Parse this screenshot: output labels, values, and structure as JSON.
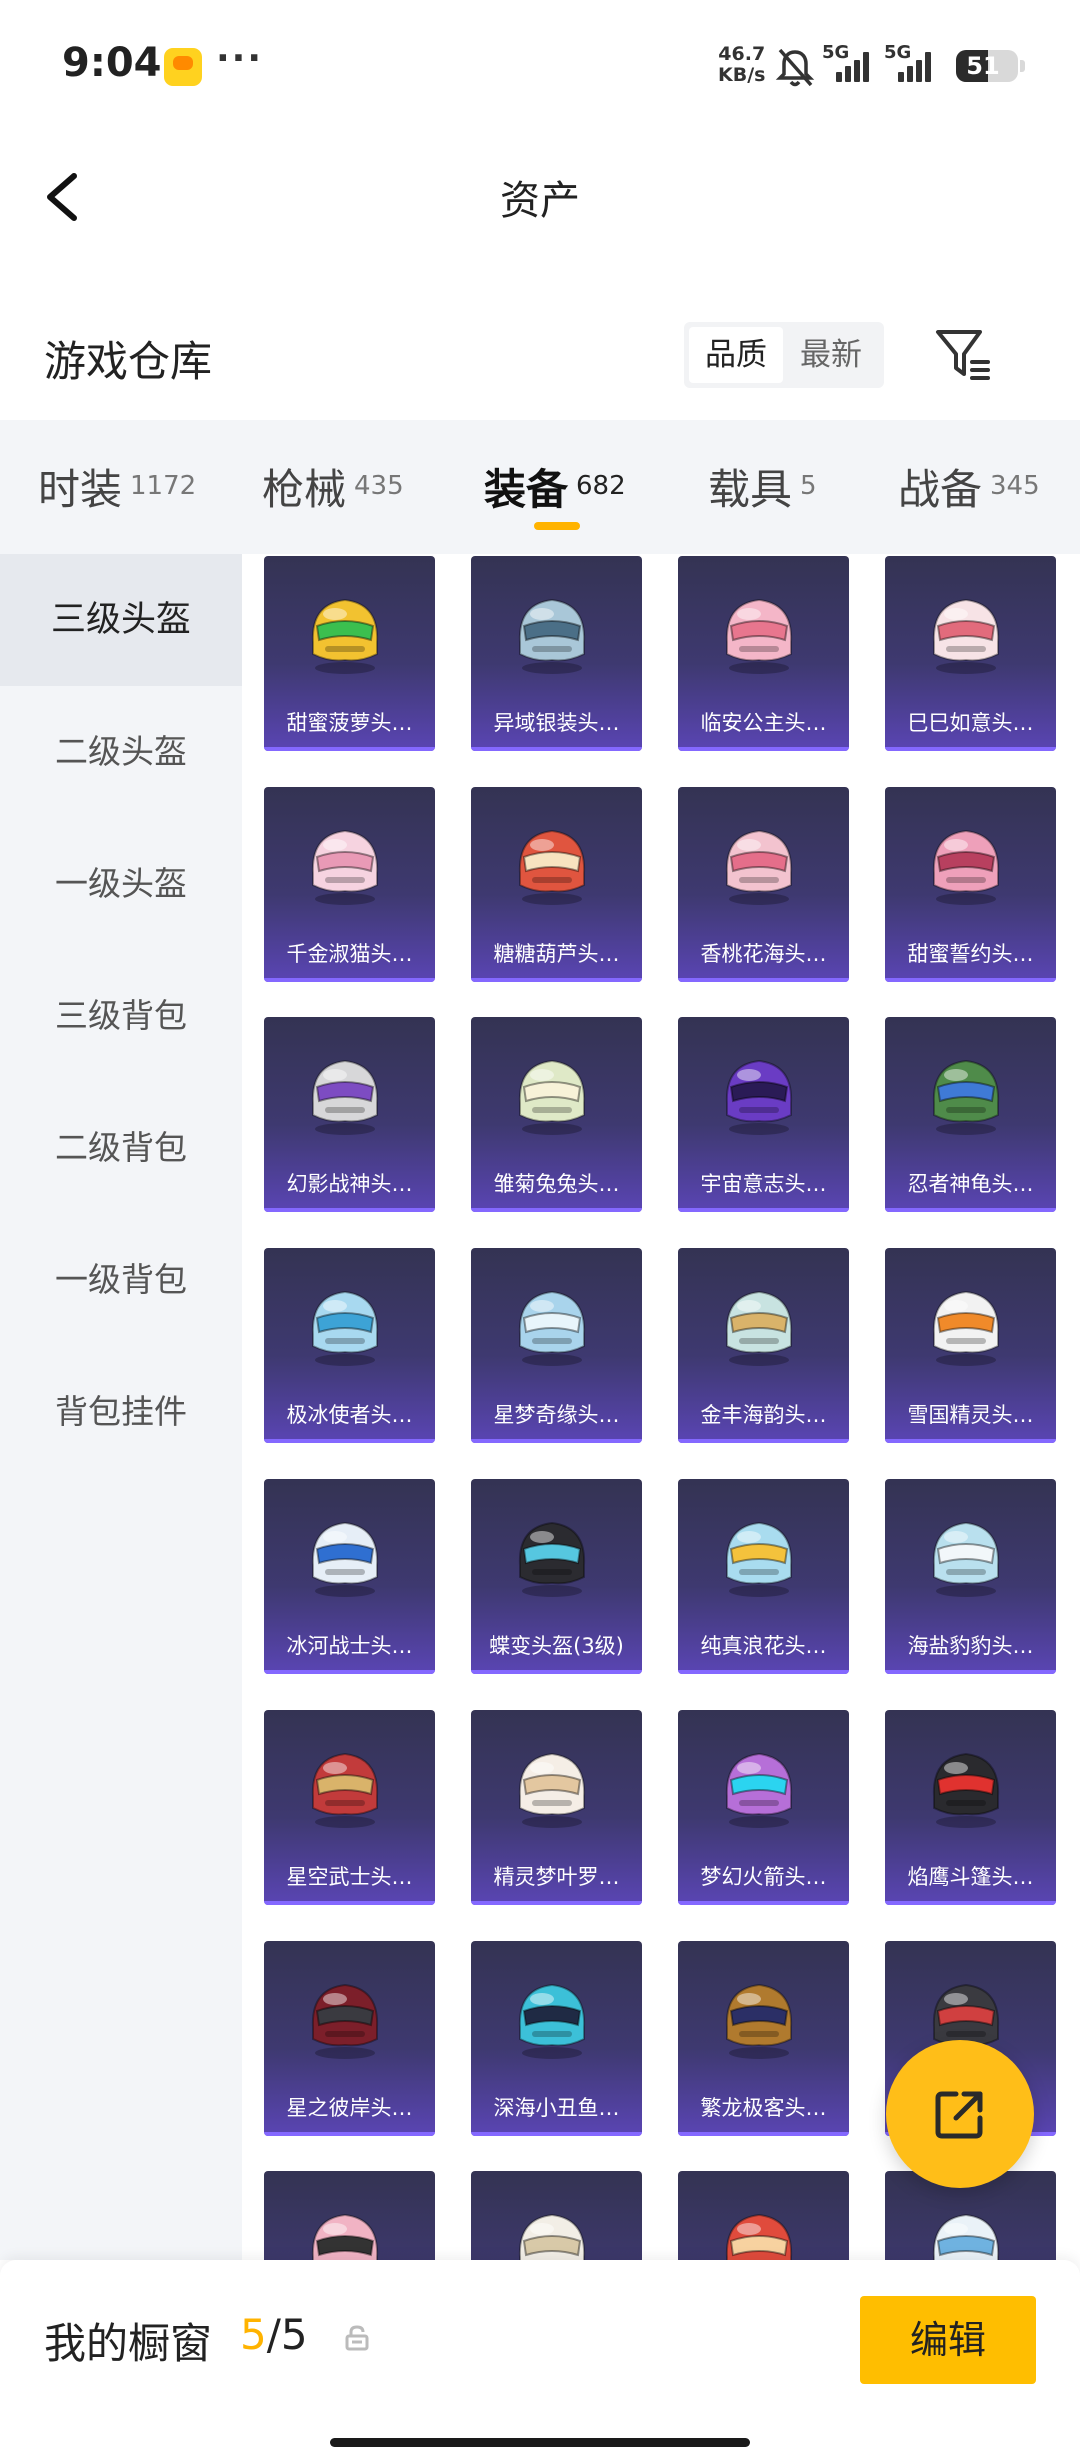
{
  "status_bar": {
    "time": "9:04",
    "more": "···",
    "speed_value": "46.7",
    "speed_unit": "KB/s",
    "signal1_label": "5G",
    "signal2_label": "5G",
    "battery": "51",
    "battery_level": 0.51
  },
  "header": {
    "title": "资产"
  },
  "warehouse": {
    "title": "游戏仓库",
    "sort_options": [
      "品质",
      "最新"
    ],
    "sort_selected": "品质"
  },
  "category_tabs": [
    {
      "name": "时装",
      "count": "1172",
      "active": false
    },
    {
      "name": "枪械",
      "count": "435",
      "active": false
    },
    {
      "name": "装备",
      "count": "682",
      "active": true
    },
    {
      "name": "载具",
      "count": "5",
      "active": false
    },
    {
      "name": "战备",
      "count": "345",
      "active": false
    }
  ],
  "sidebar": {
    "items": [
      {
        "label": "三级头盔",
        "active": true
      },
      {
        "label": "二级头盔",
        "active": false
      },
      {
        "label": "一级头盔",
        "active": false
      },
      {
        "label": "三级背包",
        "active": false
      },
      {
        "label": "二级背包",
        "active": false
      },
      {
        "label": "一级背包",
        "active": false
      },
      {
        "label": "背包挂件",
        "active": false
      }
    ]
  },
  "items": [
    {
      "name": "甜蜜菠萝头…",
      "icon": "pineapple-helmet-icon",
      "color": "#f2c230",
      "accent": "#3bbf4f"
    },
    {
      "name": "异域银装头…",
      "icon": "silver-helmet-icon",
      "color": "#a9c7d8",
      "accent": "#4b6f87"
    },
    {
      "name": "临安公主头…",
      "icon": "princess-helmet-icon",
      "color": "#f4b6c8",
      "accent": "#e8768e"
    },
    {
      "name": "巳巳如意头…",
      "icon": "ruyi-helmet-icon",
      "color": "#f7e3e6",
      "accent": "#e26b7c"
    },
    {
      "name": "千金淑猫头…",
      "icon": "cat-helmet-icon",
      "color": "#f6d3e0",
      "accent": "#e99ab6"
    },
    {
      "name": "糖糖葫芦头…",
      "icon": "candy-gourd-helmet-icon",
      "color": "#e0553f",
      "accent": "#f7e3c0"
    },
    {
      "name": "香桃花海头…",
      "icon": "peach-helmet-icon",
      "color": "#f3c3cf",
      "accent": "#e56e8a"
    },
    {
      "name": "甜蜜誓约头…",
      "icon": "vow-helmet-icon",
      "color": "#eea0ba",
      "accent": "#b8405f"
    },
    {
      "name": "幻影战神头…",
      "icon": "phantom-helmet-icon",
      "color": "#d7d7d9",
      "accent": "#7d4cc2"
    },
    {
      "name": "雏菊兔兔头…",
      "icon": "bunny-helmet-icon",
      "color": "#dfe9c7",
      "accent": "#f7f2d8"
    },
    {
      "name": "宇宙意志头…",
      "icon": "cosmic-helmet-icon",
      "color": "#6a3cc4",
      "accent": "#2a1b56"
    },
    {
      "name": "忍者神龟头…",
      "icon": "turtle-helmet-icon",
      "color": "#4f8b4a",
      "accent": "#3f7ad6"
    },
    {
      "name": "极冰使者头…",
      "icon": "ice-helmet-icon",
      "color": "#a8d9f0",
      "accent": "#3da3d6"
    },
    {
      "name": "星梦奇缘头…",
      "icon": "star-dream-helmet-icon",
      "color": "#a9d4ec",
      "accent": "#e8f5fb"
    },
    {
      "name": "金丰海韵头…",
      "icon": "sea-rhyme-helmet-icon",
      "color": "#c8e3e1",
      "accent": "#d9b36a"
    },
    {
      "name": "雪国精灵头…",
      "icon": "snow-sprite-helmet-icon",
      "color": "#f2f2f2",
      "accent": "#f08a2a"
    },
    {
      "name": "冰河战士头…",
      "icon": "glacier-helmet-icon",
      "color": "#e6eef7",
      "accent": "#2f6fd1"
    },
    {
      "name": "蝶变头盔(3级)",
      "icon": "butterfly-helmet-icon",
      "color": "#2b2b30",
      "accent": "#56c7e0"
    },
    {
      "name": "纯真浪花头…",
      "icon": "wave-helmet-icon",
      "color": "#a9dcef",
      "accent": "#f4c23c"
    },
    {
      "name": "海盐豹豹头…",
      "icon": "seal-helmet-icon",
      "color": "#b9e0ee",
      "accent": "#f2f7fa"
    },
    {
      "name": "星空武士头…",
      "icon": "star-samurai-helmet-icon",
      "color": "#c23b3b",
      "accent": "#d9b36a"
    },
    {
      "name": "精灵梦叶罗…",
      "icon": "elf-leaf-helmet-icon",
      "color": "#f5eee6",
      "accent": "#e3c7a0"
    },
    {
      "name": "梦幻火箭头…",
      "icon": "rocket-helmet-icon",
      "color": "#b66fd8",
      "accent": "#2bd4f0"
    },
    {
      "name": "焰鹰斗篷头…",
      "icon": "flame-hawk-helmet-icon",
      "color": "#2a2a2e",
      "accent": "#e0322f"
    },
    {
      "name": "星之彼岸头…",
      "icon": "star-shore-helmet-icon",
      "color": "#7c1f2a",
      "accent": "#3a3a40"
    },
    {
      "name": "深海小丑鱼…",
      "icon": "clownfish-helmet-icon",
      "color": "#3cc0d8",
      "accent": "#1f2a44"
    },
    {
      "name": "繁龙极客头…",
      "icon": "dragon-geek-helmet-icon",
      "color": "#b07a2e",
      "accent": "#2b2f66"
    },
    {
      "name": "",
      "icon": "dark-helmet-icon",
      "color": "#3a3a40",
      "accent": "#d04040"
    },
    {
      "name": "",
      "icon": "pink-visor-helmet-icon",
      "color": "#f1b3c4",
      "accent": "#333333"
    },
    {
      "name": "",
      "icon": "white-helmet-icon",
      "color": "#f2eee6",
      "accent": "#d8c9a8"
    },
    {
      "name": "",
      "icon": "red-helmet-icon",
      "color": "#e04b3c",
      "accent": "#f7d2a0"
    },
    {
      "name": "",
      "icon": "snow-beast-helmet-icon",
      "color": "#eaf2f8",
      "accent": "#6fb2e0"
    }
  ],
  "showcase": {
    "label": "我的橱窗",
    "current": "5",
    "separator": "/",
    "max": "5",
    "edit_label": "编辑"
  },
  "colors": {
    "accent": "#ffbe00",
    "tab_indicator": "#ffb300",
    "card_bg": "#3e3970"
  }
}
